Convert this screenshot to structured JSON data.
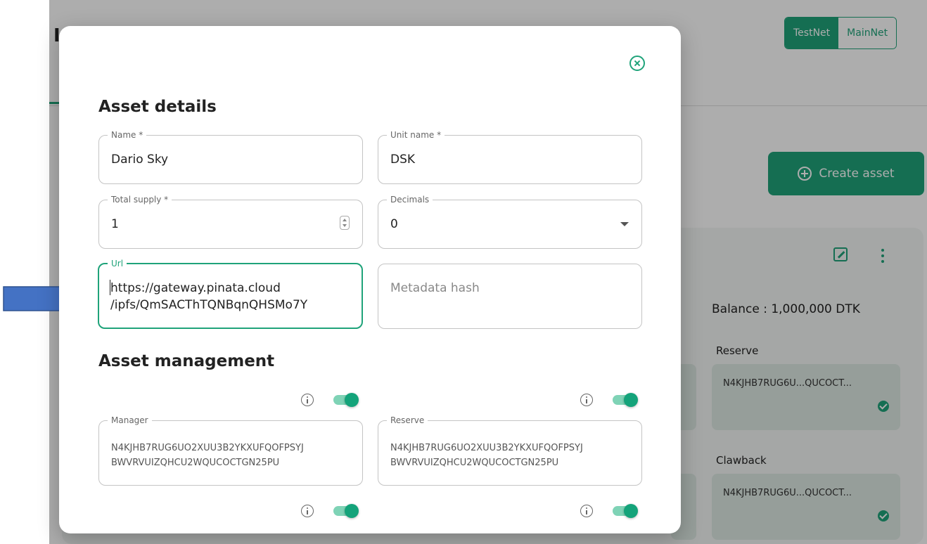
{
  "network": {
    "testnet_label": "TestNet",
    "mainnet_label": "MainNet"
  },
  "background": {
    "create_asset_label": "Create asset",
    "balance": "Balance : 1,000,000 DTK",
    "reserve_label": "Reserve",
    "clawback_label": "Clawback",
    "reserve_address": "N4KJHB7RUG6U...QUCOCT...",
    "clawback_address": "N4KJHB7RUG6U...QUCOCT..."
  },
  "modal": {
    "asset_details_title": "Asset details",
    "asset_management_title": "Asset management",
    "name": {
      "label": "Name *",
      "value": "Dario Sky"
    },
    "unit_name": {
      "label": "Unit name *",
      "value": "DSK"
    },
    "total_supply": {
      "label": "Total supply *",
      "value": "1"
    },
    "decimals": {
      "label": "Decimals",
      "value": "0"
    },
    "url": {
      "label": "Url",
      "line1": "https://gateway.pinata.cloud",
      "line2": "/ipfs/QmSACThTQNBqnQHSMo7Y"
    },
    "metadata_hash": {
      "placeholder": "Metadata hash"
    },
    "manager": {
      "label": "Manager",
      "value": "N4KJHB7RUG6UO2XUU3B2YKXUFQOFPSYJ\nBWVRVUIZQHCU2WQUCOCTGN25PU"
    },
    "reserve": {
      "label": "Reserve",
      "value": "N4KJHB7RUG6UO2XUU3B2YKXUFQOFPSYJ\nBWVRVUIZQHCU2WQUCOCTGN25PU"
    }
  },
  "colors": {
    "accent": "#1fa37a",
    "arrow": "#4472c4"
  }
}
